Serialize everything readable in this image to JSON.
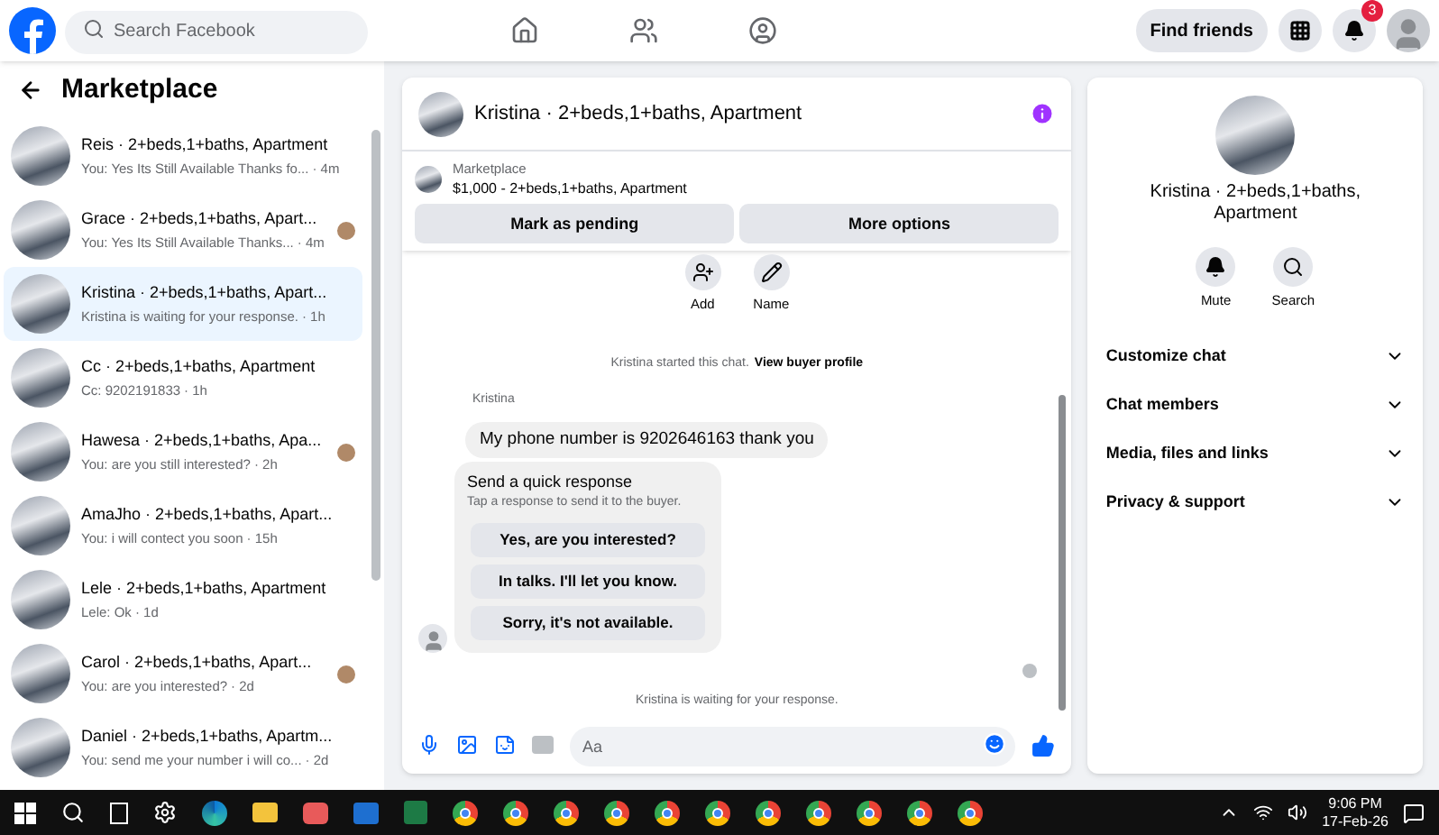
{
  "topbar": {
    "search_placeholder": "Search Facebook",
    "find_friends": "Find friends",
    "notification_count": "3"
  },
  "sidebar": {
    "title": "Marketplace",
    "conversations": [
      {
        "name": "Reis · 2+beds,1+baths, Apartment",
        "preview": "You: Yes Its Still Available Thanks fo...",
        "time": "· 4m",
        "selected": false,
        "seen": false
      },
      {
        "name": "Grace · 2+beds,1+baths, Apart...",
        "preview": "You: Yes Its Still Available Thanks...",
        "time": "· 4m",
        "selected": false,
        "seen": true
      },
      {
        "name": "Kristina · 2+beds,1+baths, Apart...",
        "preview": "Kristina is waiting for your response.",
        "time": "· 1h",
        "selected": true,
        "seen": false
      },
      {
        "name": "Cc · 2+beds,1+baths, Apartment",
        "preview": "Cc: 9202191833",
        "time": "· 1h",
        "selected": false,
        "seen": false
      },
      {
        "name": "Hawesa · 2+beds,1+baths, Apa...",
        "preview": "You: are you still interested?",
        "time": "· 2h",
        "selected": false,
        "seen": true
      },
      {
        "name": "AmaJho · 2+beds,1+baths, Apart...",
        "preview": "You: i will contect you soon",
        "time": "· 15h",
        "selected": false,
        "seen": false
      },
      {
        "name": "Lele · 2+beds,1+baths, Apartment",
        "preview": "Lele: Ok",
        "time": "· 1d",
        "selected": false,
        "seen": false
      },
      {
        "name": "Carol · 2+beds,1+baths, Apart...",
        "preview": "You: are you interested?",
        "time": "· 2d",
        "selected": false,
        "seen": true
      },
      {
        "name": "Daniel · 2+beds,1+baths, Apartm...",
        "preview": "You: send me your number i will co...",
        "time": "· 2d",
        "selected": false,
        "seen": false
      }
    ]
  },
  "chat": {
    "title": "Kristina · 2+beds,1+baths, Apartment",
    "listing": {
      "label": "Marketplace",
      "title": "$1,000 - 2+beds,1+baths, Apartment"
    },
    "buttons": [
      "Mark as pending",
      "More options"
    ],
    "actions": [
      {
        "kind": "add",
        "label": "Add"
      },
      {
        "kind": "name",
        "label": "Name"
      }
    ],
    "started_note": "Kristina started this chat.",
    "profile_link": "View buyer profile",
    "sender": "Kristina",
    "message": "My phone number is 9202646163 thank you",
    "quick_response": {
      "title": "Send a quick response",
      "hint": "Tap a response to send it to the buyer.",
      "options": [
        "Yes, are you interested?",
        "In talks. I'll let you know.",
        "Sorry, it's not available."
      ]
    },
    "waiting_note": "Kristina is waiting for your response.",
    "composer_placeholder": "Aa"
  },
  "details": {
    "title": "Kristina · 2+beds,1+baths, Apartment",
    "actions": [
      {
        "kind": "mute",
        "label": "Mute"
      },
      {
        "kind": "search",
        "label": "Search"
      }
    ],
    "sections": [
      "Customize chat",
      "Chat members",
      "Media, files and links",
      "Privacy & support"
    ]
  },
  "taskbar": {
    "time": "9:06 PM",
    "date": "17-Feb-26"
  }
}
